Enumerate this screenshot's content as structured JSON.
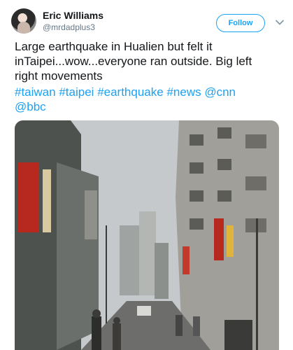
{
  "tweet": {
    "author": {
      "name": "Eric Williams",
      "handle": "@mrdadplus3"
    },
    "follow_label": "Follow",
    "text_lines": [
      "Large earthquake in Hualien but felt it",
      "inTaipei...wow...everyone ran outside. Big left",
      "right movements"
    ],
    "hashtags_line1": [
      "#taiwan",
      "#taipei",
      "#earthquake",
      "#news",
      "@cnn"
    ],
    "hashtags_line2": [
      "@bbc"
    ]
  },
  "photo": {
    "description_icon": "street-photo",
    "colors": {
      "sky": "#c9ccce",
      "building_left": "#5a5f5c",
      "building_right": "#9a9a96",
      "road": "#6d6e6c",
      "sign_red": "#b7281f",
      "sign_yellow": "#e0b43a"
    }
  },
  "colors": {
    "accent": "#1da1f2",
    "text": "#14171a",
    "muted": "#657786"
  }
}
